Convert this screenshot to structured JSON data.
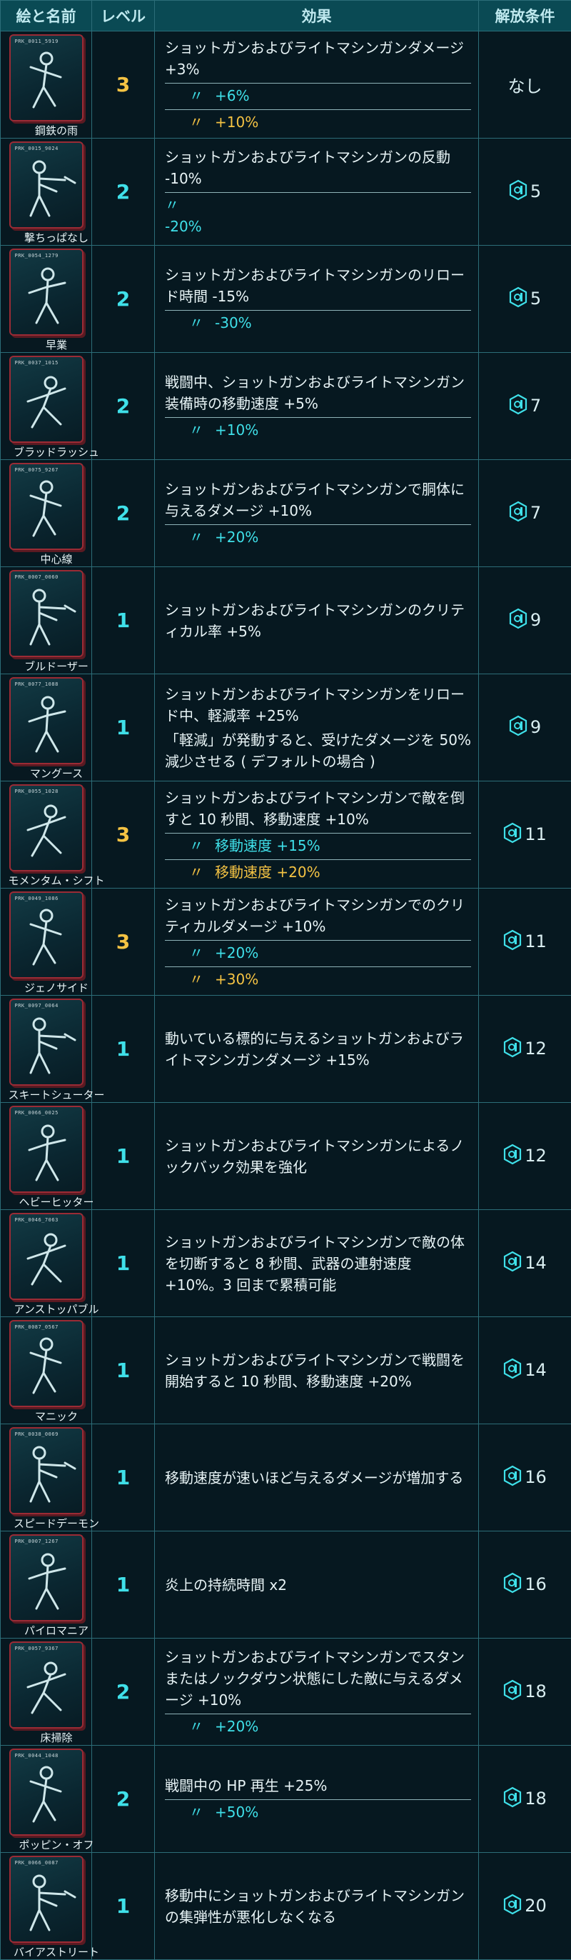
{
  "header": {
    "art_name": "絵と名前",
    "level": "レベル",
    "effect": "効果",
    "unlock": "解放条件"
  },
  "perks": [
    {
      "name": "鋼鉄の雨",
      "card_id": "PRK_0011_5919",
      "level": "3",
      "effect": "ショットガンおよびライトマシンガンダメージ +3%",
      "ranks": [
        {
          "mark": "〃",
          "text": "+6%",
          "tier": "2"
        },
        {
          "mark": "〃",
          "text": "+10%",
          "tier": "3"
        }
      ],
      "unlock": "なし",
      "unlock_icon": false
    },
    {
      "name": "撃ちっぱなし",
      "card_id": "PRK_0015_9024",
      "level": "2",
      "effect": "ショットガンおよびライトマシンガンの反動 -10%",
      "ranks": [
        {
          "mark": "〃",
          "text": "-20%",
          "tier": "2",
          "newline": true
        }
      ],
      "unlock": "5",
      "unlock_icon": true
    },
    {
      "name": "早業",
      "card_id": "PRK_0054_1279",
      "level": "2",
      "effect": "ショットガンおよびライトマシンガンのリロード時間 -15%",
      "ranks": [
        {
          "mark": "〃",
          "text": "-30%",
          "tier": "2"
        }
      ],
      "unlock": "5",
      "unlock_icon": true
    },
    {
      "name": "ブラッドラッシュ",
      "card_id": "PRK_0037_1015",
      "level": "2",
      "effect": "戦闘中、ショットガンおよびライトマシンガン装備時の移動速度 +5%",
      "ranks": [
        {
          "mark": "〃",
          "text": "+10%",
          "tier": "2"
        }
      ],
      "unlock": "7",
      "unlock_icon": true
    },
    {
      "name": "中心線",
      "card_id": "PRK_0075_9267",
      "level": "2",
      "effect": "ショットガンおよびライトマシンガンで胴体に与えるダメージ +10%",
      "ranks": [
        {
          "mark": "〃",
          "text": "+20%",
          "tier": "2"
        }
      ],
      "unlock": "7",
      "unlock_icon": true
    },
    {
      "name": "ブルドーザー",
      "card_id": "PRK_0007_0060",
      "level": "1",
      "effect": "ショットガンおよびライトマシンガンのクリティカル率 +5%",
      "ranks": [],
      "unlock": "9",
      "unlock_icon": true
    },
    {
      "name": "マングース",
      "card_id": "PRK_0077_1088",
      "level": "1",
      "effect": "ショットガンおよびライトマシンガンをリロード中、軽減率 +25%\n「軽減」が発動すると、受けたダメージを 50% 減少させる ( デフォルトの場合 )",
      "ranks": [],
      "unlock": "9",
      "unlock_icon": true
    },
    {
      "name": "モメンタム・シフト",
      "card_id": "PRK_0055_1028",
      "level": "3",
      "effect": "ショットガンおよびライトマシンガンで敵を倒すと 10 秒間、移動速度 +10%",
      "ranks": [
        {
          "mark": "〃",
          "text": "移動速度 +15%",
          "tier": "2"
        },
        {
          "mark": "〃",
          "text": "移動速度 +20%",
          "tier": "3"
        }
      ],
      "unlock": "11",
      "unlock_icon": true
    },
    {
      "name": "ジェノサイド",
      "card_id": "PRK_0049_1086",
      "level": "3",
      "effect": "ショットガンおよびライトマシンガンでのクリティカルダメージ +10%",
      "ranks": [
        {
          "mark": "〃",
          "text": "+20%",
          "tier": "2"
        },
        {
          "mark": "〃",
          "text": "+30%",
          "tier": "3"
        }
      ],
      "unlock": "11",
      "unlock_icon": true
    },
    {
      "name": "スキートシューター",
      "card_id": "PRK_0097_0064",
      "level": "1",
      "effect": "動いている標的に与えるショットガンおよびライトマシンガンダメージ +15%",
      "ranks": [],
      "unlock": "12",
      "unlock_icon": true
    },
    {
      "name": "ヘビーヒッター",
      "card_id": "PRK_0066_0025",
      "level": "1",
      "effect": "ショットガンおよびライトマシンガンによるノックバック効果を強化",
      "ranks": [],
      "unlock": "12",
      "unlock_icon": true
    },
    {
      "name": "アンストッパブル",
      "card_id": "PRK_0046_7063",
      "level": "1",
      "effect": "ショットガンおよびライトマシンガンで敵の体を切断すると 8 秒間、武器の連射速度 +10%。3 回まで累積可能",
      "ranks": [],
      "unlock": "14",
      "unlock_icon": true
    },
    {
      "name": "マニック",
      "card_id": "PRK_0087_0567",
      "level": "1",
      "effect": "ショットガンおよびライトマシンガンで戦闘を開始すると 10 秒間、移動速度 +20%",
      "ranks": [],
      "unlock": "14",
      "unlock_icon": true
    },
    {
      "name": "スピードデーモン",
      "card_id": "PRK_0038_0069",
      "level": "1",
      "effect": "移動速度が速いほど与えるダメージが増加する",
      "ranks": [],
      "unlock": "16",
      "unlock_icon": true
    },
    {
      "name": "パイロマニア",
      "card_id": "PRK_0007_1267",
      "level": "1",
      "effect": "炎上の持続時間 x2",
      "ranks": [],
      "unlock": "16",
      "unlock_icon": true
    },
    {
      "name": "床掃除",
      "card_id": "PRK_0057_9367",
      "level": "2",
      "effect": "ショットガンおよびライトマシンガンでスタンまたはノックダウン状態にした敵に与えるダメージ +10%",
      "ranks": [
        {
          "mark": "〃",
          "text": "+20%",
          "tier": "2"
        }
      ],
      "unlock": "18",
      "unlock_icon": true
    },
    {
      "name": "ポッピン・オフ",
      "card_id": "PRK_0044_1048",
      "level": "2",
      "effect": "戦闘中の HP 再生 +25%",
      "ranks": [
        {
          "mark": "〃",
          "text": "+50%",
          "tier": "2"
        }
      ],
      "unlock": "18",
      "unlock_icon": true
    },
    {
      "name": "バイアストリート",
      "card_id": "PRK_0066_0087",
      "level": "1",
      "effect": "移動中にショットガンおよびライトマシンガンの集弾性が悪化しなくなる",
      "ranks": [],
      "unlock": "20",
      "unlock_icon": true
    }
  ],
  "colors": {
    "background": "#04121a",
    "header_bg": "#0a4a54",
    "grid": "#2c6d78",
    "cyan": "#3fe0e9",
    "gold": "#f5c343",
    "card_border": "#9b2b35"
  }
}
